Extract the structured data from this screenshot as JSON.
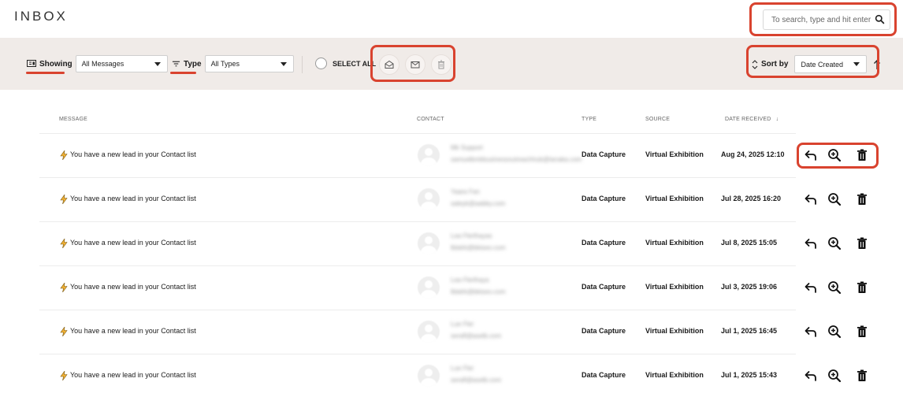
{
  "header": {
    "title": "INBOX",
    "search_placeholder": "To search, type and hit enter"
  },
  "toolbar": {
    "showing_label": "Showing",
    "showing_value": "All Messages",
    "type_label": "Type",
    "type_value": "All Types",
    "select_all_label": "SELECT ALL",
    "sort_label": "Sort by",
    "sort_value": "Date Created"
  },
  "columns": {
    "message": "MESSAGE",
    "contact": "CONTACT",
    "type": "TYPE",
    "source": "SOURCE",
    "date": "DATE RECEIVED"
  },
  "rows": [
    {
      "message": "You have a new lead in your Contact list",
      "contact_name": "Mk Support",
      "contact_email": "samuelbmkbusinessoutreachhub@tanaka.com",
      "type": "Data Capture",
      "source": "Virtual Exhibition",
      "date": "Aug 24, 2025 12:10"
    },
    {
      "message": "You have a new lead in your Contact list",
      "contact_name": "Yaara Fan",
      "contact_email": "saleyk@aabby.com",
      "type": "Data Capture",
      "source": "Virtual Exhibition",
      "date": "Jul 28, 2025 16:20"
    },
    {
      "message": "You have a new lead in your Contact list",
      "contact_name": "Lea Flerlhayas",
      "contact_email": "lblalrk@bkiseo.com",
      "type": "Data Capture",
      "source": "Virtual Exhibition",
      "date": "Jul 8, 2025 15:05"
    },
    {
      "message": "You have a new lead in your Contact list",
      "contact_name": "Lea Flerlhaya",
      "contact_email": "lblalrk@bkiseo.com",
      "type": "Data Capture",
      "source": "Virtual Exhibition",
      "date": "Jul 3, 2025 19:06"
    },
    {
      "message": "You have a new lead in your Contact list",
      "contact_name": "Lue Fler",
      "contact_email": "serafl@aselb.com",
      "type": "Data Capture",
      "source": "Virtual Exhibition",
      "date": "Jul 1, 2025 16:45"
    },
    {
      "message": "You have a new lead in your Contact list",
      "contact_name": "Lue Fler",
      "contact_email": "serafl@aselb.com",
      "type": "Data Capture",
      "source": "Virtual Exhibition",
      "date": "Jul 1, 2025 15:43"
    }
  ],
  "colors": {
    "accent": "#d9432f",
    "toolbar_bg": "#f0ebe8"
  },
  "icons": {
    "message": "lightning-icon",
    "reply": "reply-icon",
    "view": "zoom-in-icon",
    "delete": "trash-icon"
  }
}
